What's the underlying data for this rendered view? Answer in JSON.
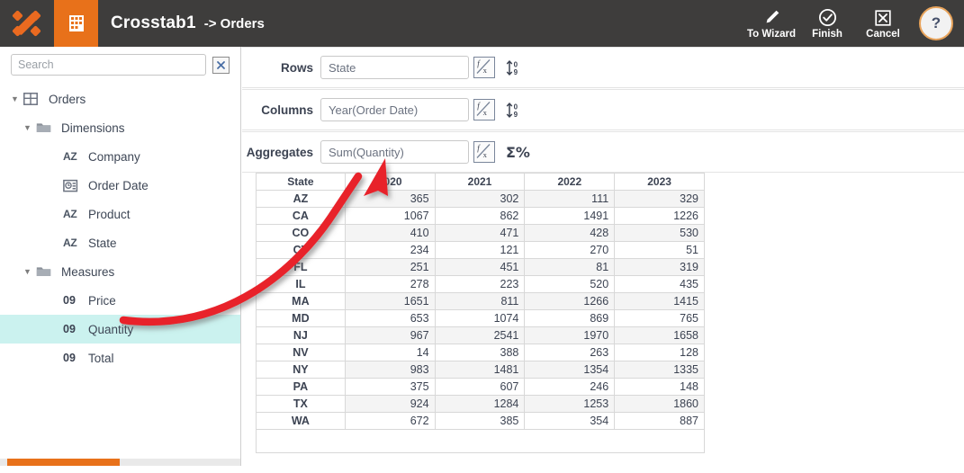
{
  "header": {
    "logo_icon": "app-logo-icon",
    "module_icon": "crosstab-grid-icon",
    "title": "Crosstab1",
    "subtitle": "-> Orders",
    "tools": [
      {
        "label": "To Wizard",
        "icon": "pencil-icon"
      },
      {
        "label": "Finish",
        "icon": "check-circle-icon"
      },
      {
        "label": "Cancel",
        "icon": "close-box-icon"
      }
    ],
    "help_label": "?"
  },
  "sidebar": {
    "search": {
      "placeholder": "Search",
      "value": "",
      "clear_icon": "clear-x-icon"
    },
    "tree": [
      {
        "level": 0,
        "caret": "▼",
        "icon": "table-icon",
        "icon_kind": "table",
        "label": "Orders",
        "selected": false
      },
      {
        "level": 1,
        "caret": "▼",
        "icon": "folder-icon",
        "icon_kind": "folder",
        "label": "Dimensions",
        "selected": false
      },
      {
        "level": 2,
        "caret": "",
        "icon": "text-az-icon",
        "icon_kind": "az",
        "label": "Company",
        "selected": false
      },
      {
        "level": 2,
        "caret": "",
        "icon": "date-icon",
        "icon_kind": "date",
        "label": "Order Date",
        "selected": false
      },
      {
        "level": 2,
        "caret": "",
        "icon": "text-az-icon",
        "icon_kind": "az",
        "label": "Product",
        "selected": false
      },
      {
        "level": 2,
        "caret": "",
        "icon": "text-az-icon",
        "icon_kind": "az",
        "label": "State",
        "selected": false
      },
      {
        "level": 1,
        "caret": "▼",
        "icon": "folder-icon",
        "icon_kind": "folder",
        "label": "Measures",
        "selected": false
      },
      {
        "level": 2,
        "caret": "",
        "icon": "number-09-icon",
        "icon_kind": "num",
        "label": "Price",
        "selected": false
      },
      {
        "level": 2,
        "caret": "",
        "icon": "number-09-icon",
        "icon_kind": "num",
        "label": "Quantity",
        "selected": true
      },
      {
        "level": 2,
        "caret": "",
        "icon": "number-09-icon",
        "icon_kind": "num",
        "label": "Total",
        "selected": false
      }
    ],
    "scrollbar_color": "#e8711a"
  },
  "fields": [
    {
      "label": "Rows",
      "value": "State",
      "formula_icon": "fx-icon",
      "extra_icon": "sort-numeric-icon"
    },
    {
      "label": "Columns",
      "value": "Year(Order Date)",
      "formula_icon": "fx-icon",
      "extra_icon": "sort-numeric-icon"
    },
    {
      "label": "Aggregates",
      "value": "Sum(Quantity)",
      "formula_icon": "fx-icon",
      "extra_icon": "sigma-percent-icon",
      "extra_text": "Σ%"
    }
  ],
  "crosstab": {
    "columns": [
      "State",
      "2020",
      "2021",
      "2022",
      "2023"
    ],
    "rows": [
      {
        "state": "AZ",
        "values": [
          365,
          302,
          111,
          329
        ]
      },
      {
        "state": "CA",
        "values": [
          1067,
          862,
          1491,
          1226
        ]
      },
      {
        "state": "CO",
        "values": [
          410,
          471,
          428,
          530
        ]
      },
      {
        "state": "CT",
        "values": [
          234,
          121,
          270,
          51
        ]
      },
      {
        "state": "FL",
        "values": [
          251,
          451,
          81,
          319
        ]
      },
      {
        "state": "IL",
        "values": [
          278,
          223,
          520,
          435
        ]
      },
      {
        "state": "MA",
        "values": [
          1651,
          811,
          1266,
          1415
        ]
      },
      {
        "state": "MD",
        "values": [
          653,
          1074,
          869,
          765
        ]
      },
      {
        "state": "NJ",
        "values": [
          967,
          2541,
          1970,
          1658
        ]
      },
      {
        "state": "NV",
        "values": [
          14,
          388,
          263,
          128
        ]
      },
      {
        "state": "NY",
        "values": [
          983,
          1481,
          1354,
          1335
        ]
      },
      {
        "state": "PA",
        "values": [
          375,
          607,
          246,
          148
        ]
      },
      {
        "state": "TX",
        "values": [
          924,
          1284,
          1253,
          1860
        ]
      },
      {
        "state": "WA",
        "values": [
          672,
          385,
          354,
          887
        ]
      }
    ]
  },
  "annotation": {
    "arrow_color": "#e8202a",
    "description": "curved arrow from Quantity measure to Aggregates field"
  },
  "colors": {
    "header_bg": "#3e3d3c",
    "accent_orange": "#e8711a",
    "selection_cyan": "#cbf2ef"
  }
}
